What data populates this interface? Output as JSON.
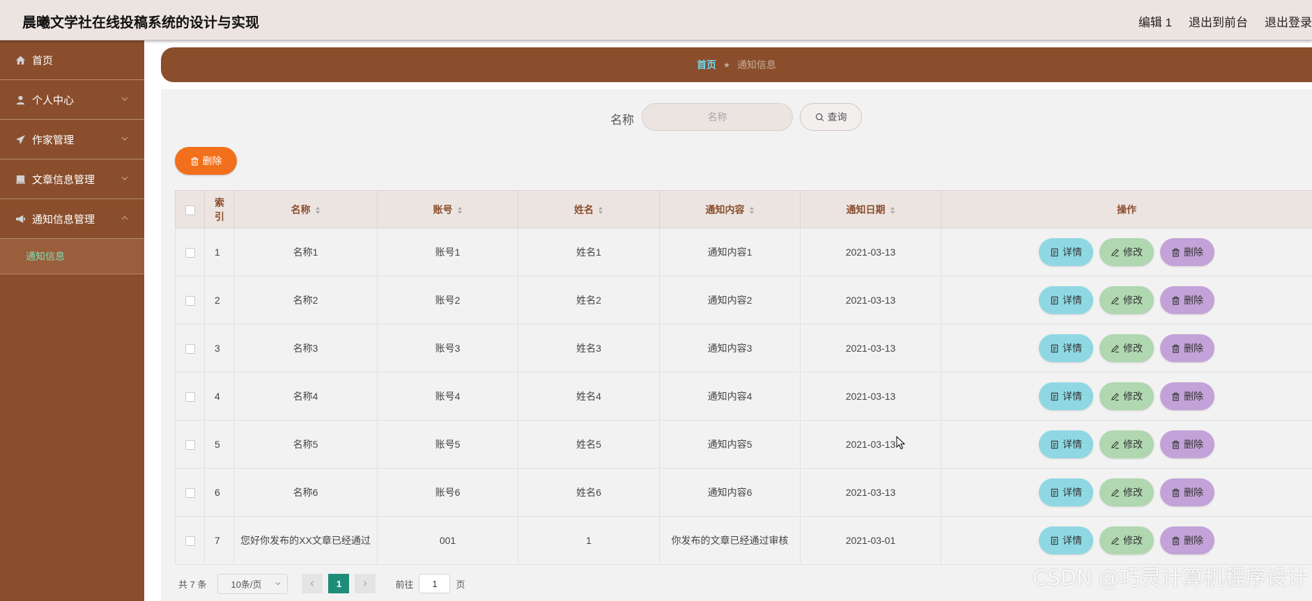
{
  "header": {
    "title": "晨曦文学社在线投稿系统的设计与实现",
    "links": [
      "编辑 1",
      "退出到前台",
      "退出登录"
    ]
  },
  "sidebar": {
    "items": [
      {
        "label": "首页",
        "icon": "home-icon"
      },
      {
        "label": "个人中心",
        "icon": "user-icon"
      },
      {
        "label": "作家管理",
        "icon": "paper-plane-icon"
      },
      {
        "label": "文章信息管理",
        "icon": "document-icon"
      },
      {
        "label": "通知信息管理",
        "icon": "notification-icon"
      }
    ],
    "sub_active": "通知信息"
  },
  "breadcrumb": {
    "home": "首页",
    "current": "通知信息"
  },
  "search": {
    "label": "名称",
    "placeholder": "名称",
    "button": "查询"
  },
  "toolbar": {
    "bulk_delete": "删除"
  },
  "table": {
    "headers": [
      "索引",
      "名称",
      "账号",
      "姓名",
      "通知内容",
      "通知日期",
      "操作"
    ],
    "rows": [
      {
        "index": "1",
        "name": "名称1",
        "account": "账号1",
        "person": "姓名1",
        "content": "通知内容1",
        "date": "2021-03-13"
      },
      {
        "index": "2",
        "name": "名称2",
        "account": "账号2",
        "person": "姓名2",
        "content": "通知内容2",
        "date": "2021-03-13"
      },
      {
        "index": "3",
        "name": "名称3",
        "account": "账号3",
        "person": "姓名3",
        "content": "通知内容3",
        "date": "2021-03-13"
      },
      {
        "index": "4",
        "name": "名称4",
        "account": "账号4",
        "person": "姓名4",
        "content": "通知内容4",
        "date": "2021-03-13"
      },
      {
        "index": "5",
        "name": "名称5",
        "account": "账号5",
        "person": "姓名5",
        "content": "通知内容5",
        "date": "2021-03-13"
      },
      {
        "index": "6",
        "name": "名称6",
        "account": "账号6",
        "person": "姓名6",
        "content": "通知内容6",
        "date": "2021-03-13"
      },
      {
        "index": "7",
        "name": "您好你发布的XX文章已经通过",
        "account": "001",
        "person": "1",
        "content": "你发布的文章已经通过审核",
        "date": "2021-03-01"
      }
    ],
    "actions": {
      "detail": "详情",
      "edit": "修改",
      "delete": "删除"
    }
  },
  "pagination": {
    "total": "共 7 条",
    "page_size": "10条/页",
    "current_page": "1",
    "goto_label": "前往",
    "goto_value": "1",
    "page_suffix": "页"
  },
  "watermark": "CSDN @巧灵计算机程序设计",
  "colors": {
    "sidebar_bg": "#8a4e2c",
    "header_bg": "#ece4e1",
    "content_bg": "#f2f2f2",
    "delete_btn": "#f26f1c",
    "detail_btn": "#8fd8e3",
    "edit_btn": "#b0d7b0",
    "row_delete_btn": "#c2a2d8",
    "active_page": "#1e8d78",
    "submenu_active_text": "#79e0b5"
  }
}
